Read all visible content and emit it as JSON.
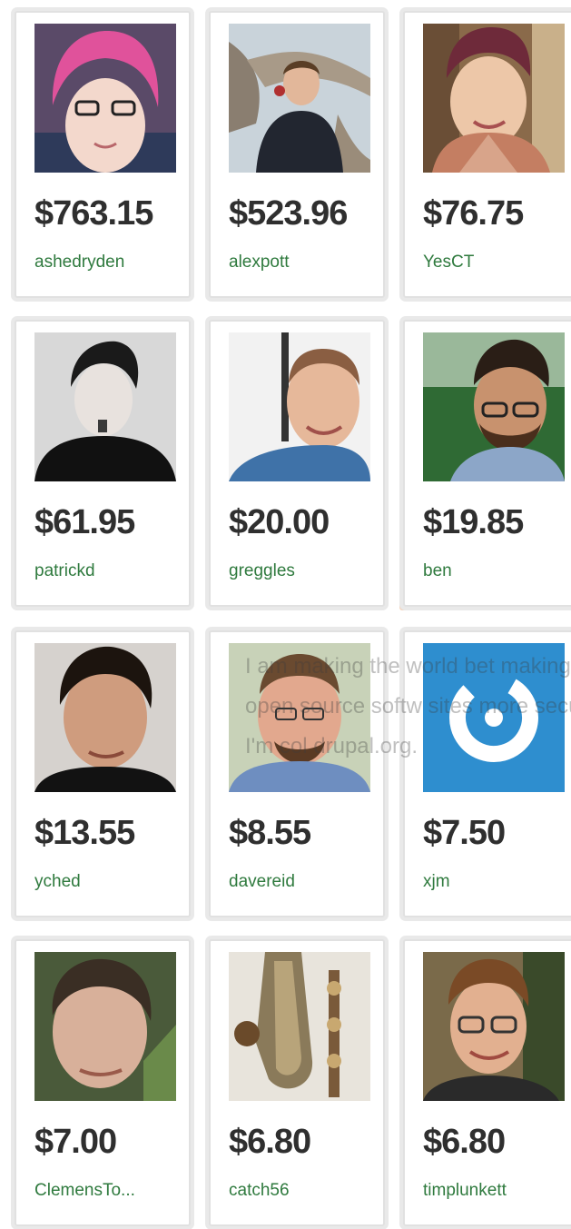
{
  "cards": [
    {
      "amount": "$763.15",
      "username": "ashedryden",
      "icon": "avatar-pink-hair"
    },
    {
      "amount": "$523.96",
      "username": "alexpott",
      "icon": "avatar-outdoor-tree"
    },
    {
      "amount": "$76.75",
      "username": "YesCT",
      "icon": "avatar-smiling-woman"
    },
    {
      "amount": "$61.95",
      "username": "patrickd",
      "icon": "avatar-grayscale-man"
    },
    {
      "amount": "$20.00",
      "username": "greggles",
      "icon": "avatar-bald-man"
    },
    {
      "amount": "$19.85",
      "username": "ben",
      "icon": "avatar-bearded-glasses"
    },
    {
      "amount": "$13.55",
      "username": "yched",
      "icon": "avatar-dark-hair-man"
    },
    {
      "amount": "$8.55",
      "username": "davereid",
      "icon": "avatar-round-face"
    },
    {
      "amount": "$7.50",
      "username": "xjm",
      "icon": "avatar-power-logo"
    },
    {
      "amount": "$7.00",
      "username": "ClemensTo...",
      "icon": "avatar-short-hair-man"
    },
    {
      "amount": "$6.80",
      "username": "catch56",
      "icon": "avatar-saxophone"
    },
    {
      "amount": "$6.80",
      "username": "timplunkett",
      "icon": "avatar-glasses-man"
    }
  ],
  "overlay_text": "I am making the world bet making open source softw sites more secure. I'm col drupal.org.",
  "colors": {
    "amount_text": "#2f2f2f",
    "username_link": "#2f7a3e",
    "card_border": "#e1e1e1",
    "xjm_logo_bg": "#2e8ecf"
  }
}
